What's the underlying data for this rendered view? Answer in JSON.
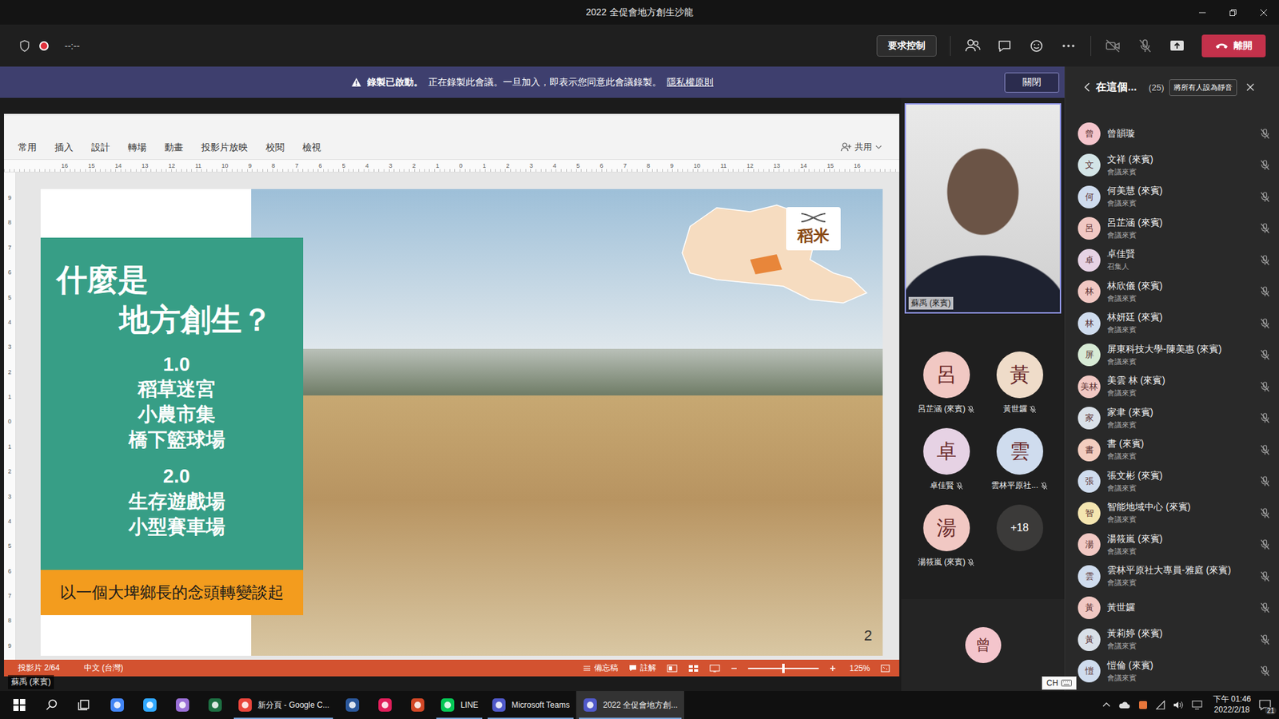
{
  "window": {
    "title": "2022 全促會地方創生沙龍"
  },
  "toolbar": {
    "timer": "--:--",
    "recording": true,
    "request_control": "要求控制",
    "camera_on": false,
    "mic_on": false,
    "leave": "離開"
  },
  "banner": {
    "title": "錄製已啟動。",
    "text": "正在錄製此會議。一旦加入，即表示您同意此會議錄製。",
    "link": "隱私權原則",
    "close": "關閉"
  },
  "presentation": {
    "ribbon_tabs": [
      {
        "label": "常用",
        "selected": false
      },
      {
        "label": "插入",
        "selected": false
      },
      {
        "label": "設計",
        "selected": false
      },
      {
        "label": "轉場",
        "selected": false
      },
      {
        "label": "動畫",
        "selected": false
      },
      {
        "label": "投影片放映",
        "selected": false
      },
      {
        "label": "校閱",
        "selected": false
      },
      {
        "label": "檢視",
        "selected": false
      }
    ],
    "share": "共用",
    "ruler_h": [
      "16",
      "15",
      "14",
      "13",
      "12",
      "11",
      "10",
      "9",
      "8",
      "7",
      "6",
      "5",
      "4",
      "3",
      "2",
      "1",
      "0",
      "1",
      "2",
      "3",
      "4",
      "5",
      "6",
      "7",
      "8",
      "9",
      "10",
      "11",
      "12",
      "13",
      "14",
      "15",
      "16"
    ],
    "ruler_v": [
      "9",
      "8",
      "7",
      "6",
      "5",
      "4",
      "3",
      "2",
      "1",
      "0",
      "1",
      "2",
      "3",
      "4",
      "5",
      "6",
      "7",
      "8",
      "9"
    ],
    "slide": {
      "heading": [
        "什麼是",
        "地方創生？"
      ],
      "sections": [
        {
          "version": "1.0",
          "items": [
            "稻草迷宮",
            "小農市集",
            "橋下籃球場"
          ]
        },
        {
          "version": "2.0",
          "items": [
            "生存遊戲場",
            "小型賽車場"
          ]
        }
      ],
      "footer": "以一個大埤鄉長的念頭轉變談起",
      "map_label": "稻米",
      "page_number": "2"
    },
    "status": {
      "slide_info": "投影片 2/64",
      "language": "中文 (台灣)",
      "notes": "備忘稿",
      "comments": "註解",
      "zoom": "125%",
      "zoom_level": 0.5
    }
  },
  "presenter_label": "蘇禹 (來賓)",
  "video": {
    "name": "蘇禹 (來賓)"
  },
  "gallery": {
    "tiles": [
      {
        "initial": "呂",
        "name": "呂芷涵 (來賓)",
        "color": "#f1c8c3",
        "mic_on": false
      },
      {
        "initial": "黃",
        "name": "黃世鑼",
        "color": "#efdcc9",
        "mic_on": false
      },
      {
        "initial": "卓",
        "name": "卓佳賢",
        "color": "#e6d2e4",
        "mic_on": false
      },
      {
        "initial": "雲",
        "name": "雲林平原社...",
        "color": "#cfdcee",
        "mic_on": false
      },
      {
        "initial": "湯",
        "name": "湯筱嵐 (來賓)",
        "color": "#f1c8c3",
        "mic_on": false
      }
    ],
    "more": "+18",
    "pinned": {
      "initial": "曾",
      "color": "#f4c5cc"
    }
  },
  "participants": {
    "title": "在這個...",
    "count": "(25)",
    "mute_all": "將所有人設為靜音",
    "items": [
      {
        "initial": "曾",
        "name": "曾韻璇",
        "role": null,
        "color": "#f4c5cc",
        "mic_on": false
      },
      {
        "initial": "文",
        "name": "文祥 (來賓)",
        "role": "會議來賓",
        "color": "#d3e4e6",
        "mic_on": false
      },
      {
        "initial": "何",
        "name": "何美慧 (來賓)",
        "role": "會議來賓",
        "color": "#cfdcee",
        "mic_on": false
      },
      {
        "initial": "呂",
        "name": "呂芷涵 (來賓)",
        "role": "會議來賓",
        "color": "#f1c8c3",
        "mic_on": false
      },
      {
        "initial": "卓",
        "name": "卓佳賢",
        "role": "召集人",
        "color": "#e6d2e4",
        "mic_on": false
      },
      {
        "initial": "林",
        "name": "林欣儀 (來賓)",
        "role": "會議來賓",
        "color": "#f1c8c3",
        "mic_on": false
      },
      {
        "initial": "林",
        "name": "林妍廷 (來賓)",
        "role": "會議來賓",
        "color": "#cfdcee",
        "mic_on": false
      },
      {
        "initial": "屏",
        "name": "屏東科技大學-陳美惠 (來賓)",
        "role": "會議來賓",
        "color": "#d7ead5",
        "mic_on": false
      },
      {
        "initial": "美林",
        "name": "美雲 林 (來賓)",
        "role": "會議來賓",
        "color": "#f1c8c3",
        "mic_on": false
      },
      {
        "initial": "家",
        "name": "家聿 (來賓)",
        "role": "會議來賓",
        "color": "#d9e0e8",
        "mic_on": false
      },
      {
        "initial": "書",
        "name": "書 (來賓)",
        "role": "會議來賓",
        "color": "#f3cdbf",
        "mic_on": false
      },
      {
        "initial": "張",
        "name": "張文彬 (來賓)",
        "role": "會議來賓",
        "color": "#cfdcee",
        "mic_on": false
      },
      {
        "initial": "智",
        "name": "智能地域中心 (來賓)",
        "role": "會議來賓",
        "color": "#f4e5b0",
        "mic_on": false
      },
      {
        "initial": "湯",
        "name": "湯筱嵐 (來賓)",
        "role": "會議來賓",
        "color": "#f1c8c3",
        "mic_on": false
      },
      {
        "initial": "雲",
        "name": "雲林平原社大專員-雅庭 (來賓)",
        "role": "會議來賓",
        "color": "#cfdcee",
        "mic_on": false
      },
      {
        "initial": "黃",
        "name": "黃世鑼",
        "role": null,
        "color": "#f1c8c3",
        "mic_on": false
      },
      {
        "initial": "黃",
        "name": "黃莉婷 (來賓)",
        "role": "會議來賓",
        "color": "#d9e0e8",
        "mic_on": false
      },
      {
        "initial": "愷",
        "name": "愷倫 (來賓)",
        "role": "會議來賓",
        "color": "#cfdcee",
        "mic_on": false
      }
    ]
  },
  "taskbar": {
    "items": [
      {
        "kind": "start",
        "color": "#ffffff",
        "label": null,
        "selected": false
      },
      {
        "kind": "search",
        "color": "#ffffff",
        "label": null,
        "selected": false
      },
      {
        "kind": "taskview",
        "color": "#ffffff",
        "label": null,
        "selected": false
      },
      {
        "kind": "app",
        "color": "#4285f4",
        "label": null,
        "selected": false
      },
      {
        "kind": "app",
        "color": "#31a8ff",
        "label": null,
        "selected": false
      },
      {
        "kind": "app",
        "color": "#9a6fd6",
        "label": null,
        "selected": false
      },
      {
        "kind": "app",
        "color": "#1d6f42",
        "label": null,
        "selected": false
      },
      {
        "kind": "app",
        "color": "#e8453c",
        "label": "新分頁 - Google C...",
        "selected": false
      },
      {
        "kind": "app",
        "color": "#2b579a",
        "label": null,
        "selected": false
      },
      {
        "kind": "app",
        "color": "#e01e5a",
        "label": null,
        "selected": false
      },
      {
        "kind": "app",
        "color": "#d24726",
        "label": null,
        "selected": false
      },
      {
        "kind": "app",
        "color": "#06c755",
        "label": "LINE",
        "selected": false
      },
      {
        "kind": "app",
        "color": "#5059c9",
        "label": "Microsoft Teams",
        "selected": false
      },
      {
        "kind": "app",
        "color": "#5059c9",
        "label": "2022 全促會地方創...",
        "selected": true
      }
    ],
    "time": "下午 01:46",
    "date": "2022/2/18",
    "notifications": "21"
  },
  "ime": "CH"
}
